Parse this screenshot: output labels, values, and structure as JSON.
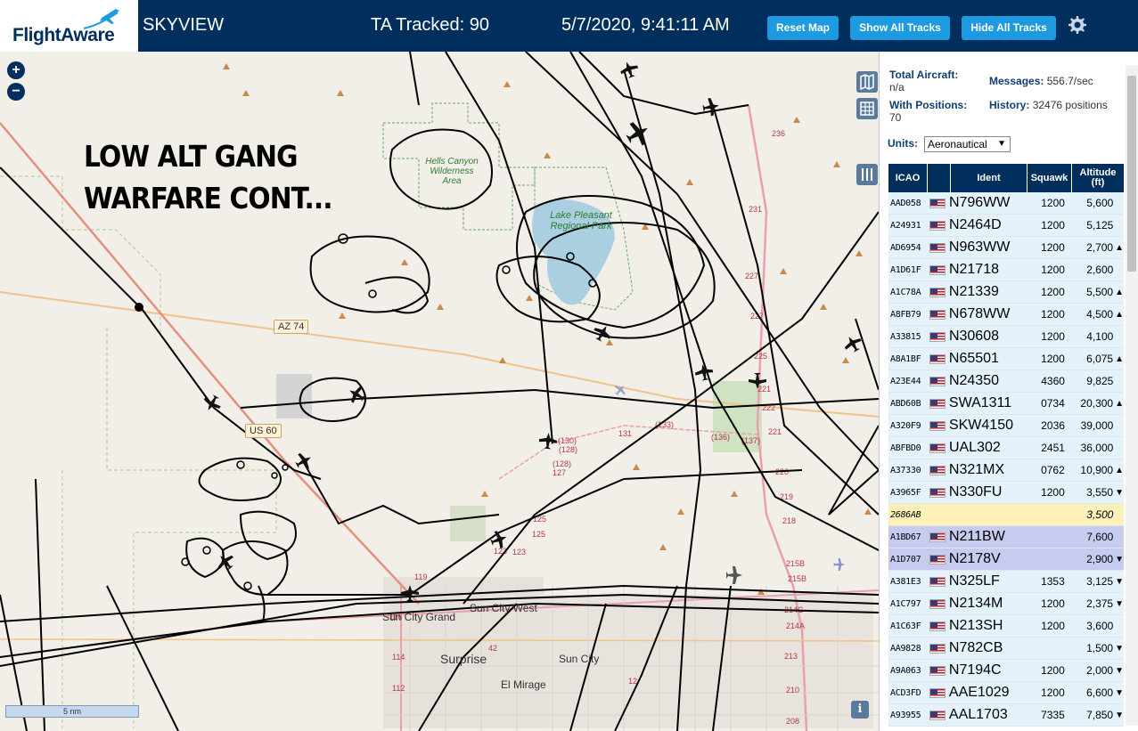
{
  "header": {
    "logo_text": "FlightAware",
    "app_title": "SKYVIEW",
    "ta_tracked": "TA Tracked: 90",
    "datetime": "5/7/2020, 9:41:11 AM",
    "reset_map": "Reset Map",
    "show_all_tracks": "Show All Tracks",
    "hide_all_tracks": "Hide All Tracks",
    "settings_icon": "gear-icon"
  },
  "map": {
    "overlay_line1": "LOW ALT GANG",
    "overlay_line2": "WARFARE CONT...",
    "zoom_in": "+",
    "zoom_out": "−",
    "scale": "5 nm",
    "info": "i",
    "labels": {
      "hells_canyon": "Hells Canyon Wilderness Area",
      "lake_pleasant": "Lake Pleasant Regional Park",
      "az74": "AZ 74",
      "us60": "US 60",
      "sun_city_grand": "Sun City Grand",
      "sun_city_west": "Sun City West",
      "surprise": "Surprise",
      "sun_city": "Sun City",
      "el_mirage": "El Mirage"
    }
  },
  "panel": {
    "total_aircraft_label": "Total Aircraft:",
    "total_aircraft_value": "n/a",
    "messages_label": "Messages:",
    "messages_value": "556.7/sec",
    "with_positions_label": "With Positions:",
    "with_positions_value": "70",
    "history_label": "History:",
    "history_value": "32476 positions",
    "units_label": "Units:",
    "units_value": "Aeronautical",
    "columns": [
      "ICAO",
      "",
      "Ident",
      "Squawk",
      "Altitude (ft)"
    ],
    "rows": [
      {
        "icao": "AAD058",
        "ident": "N796WW",
        "squawk": "1200",
        "alt": "5,600",
        "arrow": "",
        "flag": true
      },
      {
        "icao": "A24931",
        "ident": "N2464D",
        "squawk": "1200",
        "alt": "5,125",
        "arrow": "",
        "flag": true
      },
      {
        "icao": "AD6954",
        "ident": "N963WW",
        "squawk": "1200",
        "alt": "2,700",
        "arrow": "▲",
        "flag": true
      },
      {
        "icao": "A1D61F",
        "ident": "N21718",
        "squawk": "1200",
        "alt": "2,600",
        "arrow": "",
        "flag": true
      },
      {
        "icao": "A1C78A",
        "ident": "N21339",
        "squawk": "1200",
        "alt": "5,500",
        "arrow": "▲",
        "flag": true
      },
      {
        "icao": "A8FB79",
        "ident": "N678WW",
        "squawk": "1200",
        "alt": "4,500",
        "arrow": "▲",
        "flag": true
      },
      {
        "icao": "A33815",
        "ident": "N30608",
        "squawk": "1200",
        "alt": "4,100",
        "arrow": "",
        "flag": true
      },
      {
        "icao": "A8A1BF",
        "ident": "N65501",
        "squawk": "1200",
        "alt": "6,075",
        "arrow": "▲",
        "flag": true
      },
      {
        "icao": "A23E44",
        "ident": "N24350",
        "squawk": "4360",
        "alt": "9,825",
        "arrow": "",
        "flag": true
      },
      {
        "icao": "ABD60B",
        "ident": "SWA1311",
        "squawk": "0734",
        "alt": "20,300",
        "arrow": "▲",
        "flag": true
      },
      {
        "icao": "A320F9",
        "ident": "SKW4150",
        "squawk": "2036",
        "alt": "39,000",
        "arrow": "",
        "flag": true
      },
      {
        "icao": "ABFBD0",
        "ident": "UAL302",
        "squawk": "2451",
        "alt": "36,000",
        "arrow": "",
        "flag": true
      },
      {
        "icao": "A37330",
        "ident": "N321MX",
        "squawk": "0762",
        "alt": "10,900",
        "arrow": "▲",
        "flag": true
      },
      {
        "icao": "A3965F",
        "ident": "N330FU",
        "squawk": "1200",
        "alt": "3,550",
        "arrow": "▼",
        "flag": true
      },
      {
        "icao": "2686AB",
        "ident": "",
        "squawk": "",
        "alt": "3,500",
        "arrow": "",
        "flag": false,
        "state": "pending"
      },
      {
        "icao": "A1BD67",
        "ident": "N211BW",
        "squawk": "",
        "alt": "7,600",
        "arrow": "",
        "flag": true,
        "state": "selected"
      },
      {
        "icao": "A1D707",
        "ident": "N2178V",
        "squawk": "",
        "alt": "2,900",
        "arrow": "▼",
        "flag": true,
        "state": "selected"
      },
      {
        "icao": "A381E3",
        "ident": "N325LF",
        "squawk": "1353",
        "alt": "3,125",
        "arrow": "▼",
        "flag": true
      },
      {
        "icao": "A1C797",
        "ident": "N2134M",
        "squawk": "1200",
        "alt": "2,375",
        "arrow": "▼",
        "flag": true
      },
      {
        "icao": "A1C63F",
        "ident": "N213SH",
        "squawk": "1200",
        "alt": "3,600",
        "arrow": "",
        "flag": true
      },
      {
        "icao": "AA9828",
        "ident": "N782CB",
        "squawk": "",
        "alt": "1,500",
        "arrow": "▼",
        "flag": true
      },
      {
        "icao": "A9A063",
        "ident": "N7194C",
        "squawk": "1200",
        "alt": "2,000",
        "arrow": "▼",
        "flag": true
      },
      {
        "icao": "ACD3FD",
        "ident": "AAE1029",
        "squawk": "1200",
        "alt": "6,600",
        "arrow": "▼",
        "flag": true
      },
      {
        "icao": "A93955",
        "ident": "AAL1703",
        "squawk": "7335",
        "alt": "7,850",
        "arrow": "▼",
        "flag": true
      }
    ]
  },
  "colors": {
    "header_bg": "#002f5d",
    "button_bg": "#1e9ae0",
    "row_bg": "#e3f2fb",
    "pending_row": "#fdf0b8",
    "selected_row": "#c7cbef",
    "water": "#a9cfe0",
    "park_green": "#2e7d32"
  }
}
